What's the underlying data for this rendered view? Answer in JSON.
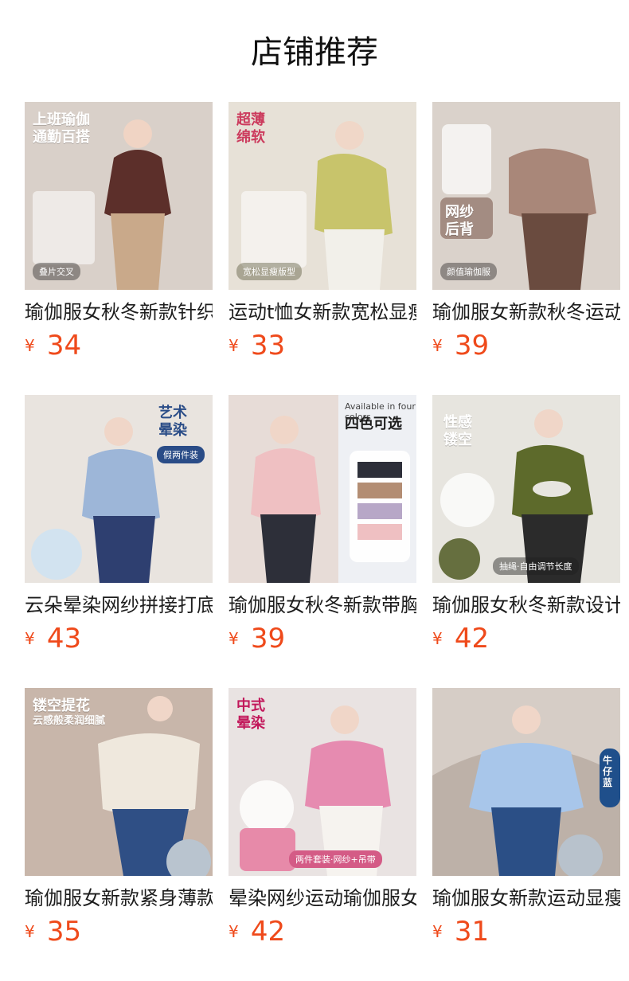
{
  "header": {
    "title": "店铺推荐"
  },
  "items": [
    {
      "name": "瑜伽服女秋冬新款针织",
      "currency": "¥",
      "price": "34",
      "overlay1": "上班瑜伽",
      "overlay2": "通勤百搭",
      "tag": "叠片交叉",
      "bg": "#d9d0c9",
      "top": "#5c2f2a",
      "bottom": "#c9a98a"
    },
    {
      "name": "运动t恤女新款宽松显瘦",
      "currency": "¥",
      "price": "33",
      "overlay1": "超薄",
      "overlay2": "绵软",
      "tag": "宽松显瘦版型",
      "bg": "#e7e1d7",
      "top": "#c8c46b",
      "bottom": "#f2f0ea"
    },
    {
      "name": "瑜伽服女新款秋冬运动",
      "currency": "¥",
      "price": "39",
      "overlay1": "网纱",
      "overlay2": "后背",
      "tag": "颜值瑜伽服",
      "bg": "#dad2cb",
      "top": "#a98779",
      "bottom": "#6a4b3f"
    },
    {
      "name": "云朵晕染网纱拼接打底",
      "currency": "¥",
      "price": "43",
      "overlay1": "艺术",
      "overlay2": "晕染",
      "tag": "假两件装",
      "bg": "#e9e4df",
      "top": "#9db6d8",
      "bottom": "#2e3f70"
    },
    {
      "name": "瑜伽服女秋冬新款带胸垫",
      "currency": "¥",
      "price": "39",
      "overlay1": "四色可选",
      "overlay2": "",
      "tag": "Available in four colors",
      "bg": "#eef0f4",
      "top": "#efc0c2",
      "bottom": "#2d2f39"
    },
    {
      "name": "瑜伽服女秋冬新款设计感",
      "currency": "¥",
      "price": "42",
      "overlay1": "性感",
      "overlay2": "镂空",
      "tag": "抽绳·自由调节长度",
      "bg": "#e7e5df",
      "top": "#5d6a2b",
      "bottom": "#2b2b2b"
    },
    {
      "name": "瑜伽服女新款紧身薄款",
      "currency": "¥",
      "price": "35",
      "overlay1": "镂空提花",
      "overlay2": "云感般柔润细腻",
      "tag": "",
      "bg": "#c8b6aa",
      "top": "#efe8dd",
      "bottom": "#2f4f85"
    },
    {
      "name": "晕染网纱运动瑜伽服女",
      "currency": "¥",
      "price": "42",
      "overlay1": "中式",
      "overlay2": "晕染",
      "tag": "两件套装·网纱+吊带",
      "bg": "#e9e3e2",
      "top": "#e68bb0",
      "bottom": "#f6f3ef"
    },
    {
      "name": "瑜伽服女新款运动显瘦",
      "currency": "¥",
      "price": "31",
      "overlay1": "牛仔",
      "overlay2": "蓝",
      "tag": "",
      "bg": "#cfc6be",
      "top": "#a8c6ea",
      "bottom": "#2b4f86"
    }
  ]
}
